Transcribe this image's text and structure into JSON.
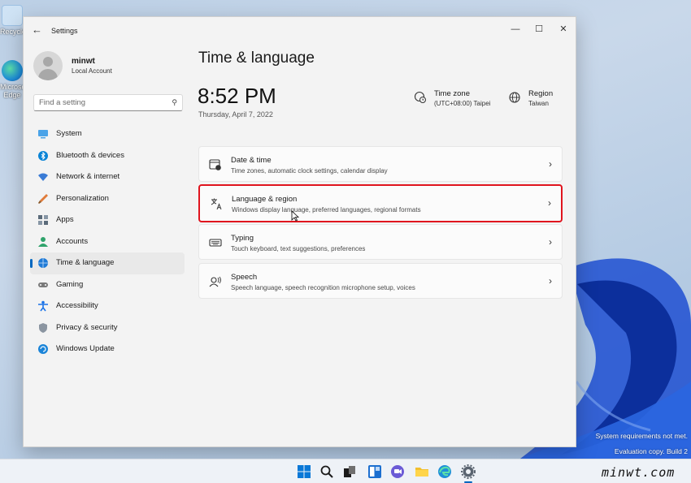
{
  "desktop": {
    "icons": [
      {
        "label": "Recycle",
        "icon": "recycle-bin-icon"
      },
      {
        "label": "Microso",
        "label2": "Edge",
        "icon": "edge-icon"
      }
    ],
    "watermark_lines": [
      "System requirements not met.",
      "Evaluation copy. Build 2"
    ]
  },
  "window": {
    "title": "Settings",
    "controls": {
      "minimize": "—",
      "maximize": "☐",
      "close": "✕"
    }
  },
  "user": {
    "name": "minwt",
    "account_type": "Local Account"
  },
  "search": {
    "placeholder": "Find a setting"
  },
  "nav": [
    {
      "label": "System",
      "icon": "system-icon",
      "color": "#4aa3e8",
      "selected": false
    },
    {
      "label": "Bluetooth & devices",
      "icon": "bluetooth-icon",
      "color": "#0a84d6",
      "selected": false
    },
    {
      "label": "Network & internet",
      "icon": "wifi-icon",
      "color": "#3a7bd5",
      "selected": false
    },
    {
      "label": "Personalization",
      "icon": "brush-icon",
      "color": "#e07b39",
      "selected": false
    },
    {
      "label": "Apps",
      "icon": "apps-icon",
      "color": "#5b6b7a",
      "selected": false
    },
    {
      "label": "Accounts",
      "icon": "accounts-icon",
      "color": "#2fa36b",
      "selected": false
    },
    {
      "label": "Time & language",
      "icon": "globe-clock-icon",
      "color": "#1f7ad6",
      "selected": true
    },
    {
      "label": "Gaming",
      "icon": "gamepad-icon",
      "color": "#7a7a7a",
      "selected": false
    },
    {
      "label": "Accessibility",
      "icon": "accessibility-icon",
      "color": "#1a73e8",
      "selected": false
    },
    {
      "label": "Privacy & security",
      "icon": "shield-icon",
      "color": "#6b7280",
      "selected": false
    },
    {
      "label": "Windows Update",
      "icon": "update-icon",
      "color": "#1a84d8",
      "selected": false
    }
  ],
  "main": {
    "title": "Time & language",
    "time": "8:52 PM",
    "date": "Thursday, April 7, 2022",
    "time_zone": {
      "label": "Time zone",
      "value": "(UTC+08:00) Taipei"
    },
    "region": {
      "label": "Region",
      "value": "Taiwan"
    },
    "cards": [
      {
        "title": "Date & time",
        "subtitle": "Time zones, automatic clock settings, calendar display",
        "icon": "calendar-clock-icon"
      },
      {
        "title": "Language & region",
        "subtitle": "Windows display language, preferred languages, regional formats",
        "icon": "language-icon",
        "highlighted": true
      },
      {
        "title": "Typing",
        "subtitle": "Touch keyboard, text suggestions, preferences",
        "icon": "keyboard-icon"
      },
      {
        "title": "Speech",
        "subtitle": "Speech language, speech recognition microphone setup, voices",
        "icon": "speech-icon"
      }
    ]
  },
  "taskbar": {
    "icons": [
      "start-icon",
      "search-icon",
      "task-view-icon",
      "widgets-icon",
      "chat-icon",
      "file-explorer-icon",
      "edge-icon",
      "settings-icon"
    ]
  },
  "brand": "minwt.com"
}
